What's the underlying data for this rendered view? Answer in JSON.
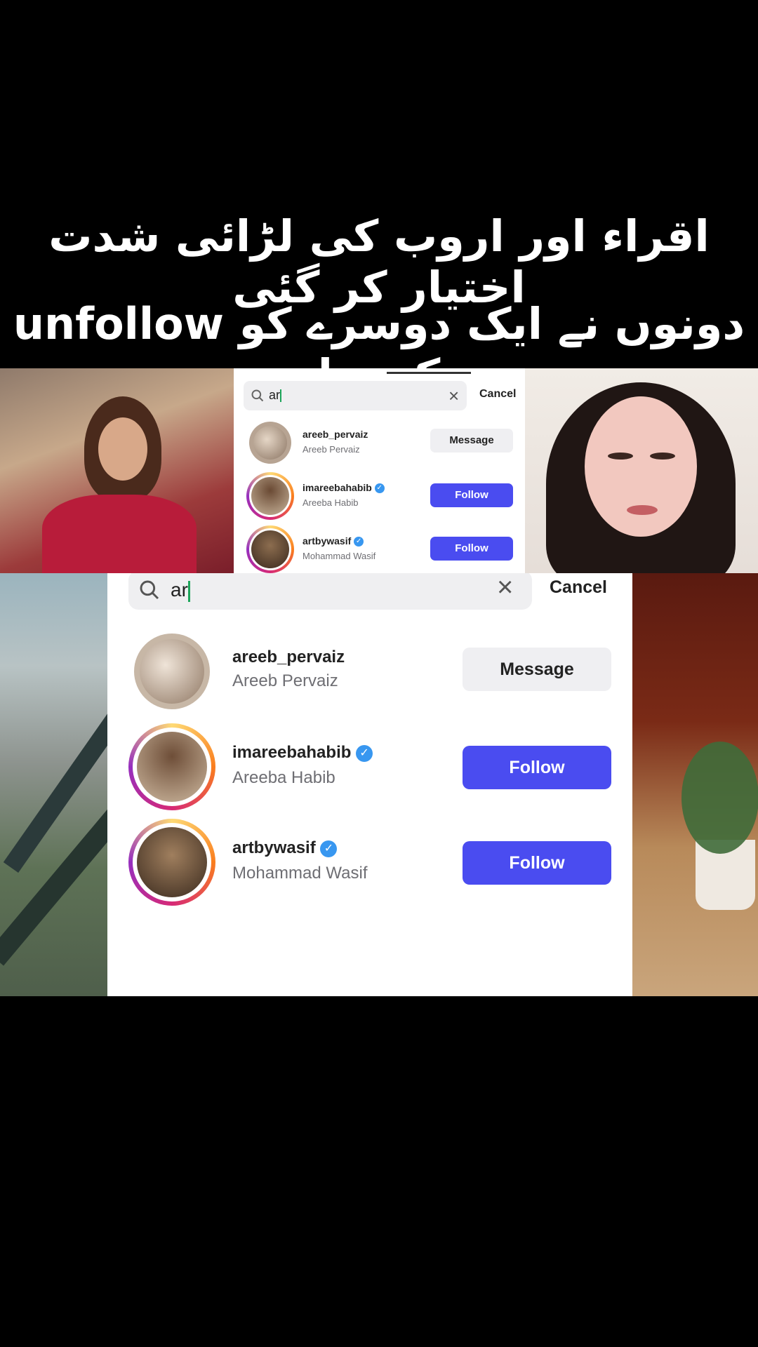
{
  "headline": {
    "line1": "اقراء اور اروب کی لڑائی شدت اختیار کر گئی",
    "line2": "دونوں نے ایک دوسرے کو unfollow کر دیا"
  },
  "search": {
    "query": "ar",
    "cancel_label": "Cancel",
    "clear_icon": "×",
    "search_icon": "search-icon"
  },
  "results": [
    {
      "username": "areeb_pervaiz",
      "full_name": "Areeb Pervaiz",
      "verified": false,
      "button": "Message"
    },
    {
      "username": "imareebahabib",
      "full_name": "Areeba Habib",
      "verified": true,
      "button": "Follow"
    },
    {
      "username": "artbywasif",
      "full_name": "Mohammad Wasif",
      "verified": true,
      "button": "Follow"
    }
  ],
  "colors": {
    "follow_button": "#4a4cf0",
    "message_button": "#efeff2",
    "verified_badge": "#3897f0",
    "background": "#000000"
  }
}
